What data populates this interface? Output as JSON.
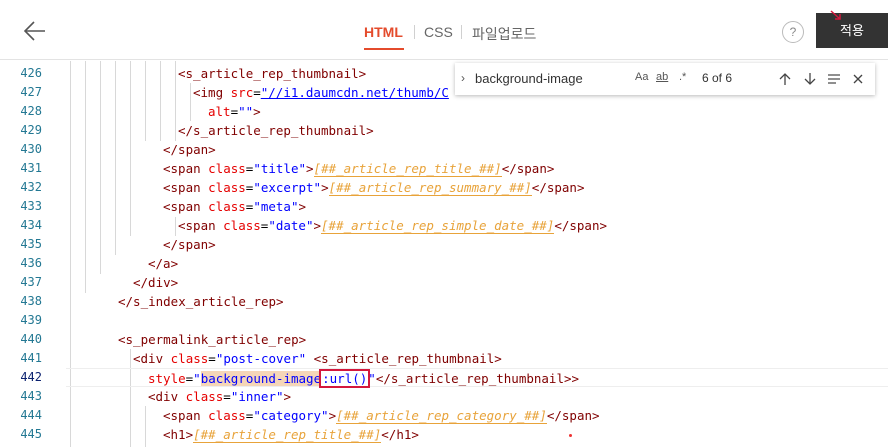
{
  "topbar": {
    "tabs": [
      "HTML",
      "CSS",
      "파일업로드"
    ],
    "active_tab": "HTML",
    "help_label": "?",
    "apply_label": "적용"
  },
  "find": {
    "query": "background-image",
    "opt_case": "Aa",
    "opt_word": "ab",
    "opt_regex": ".*",
    "count": "6 of 6"
  },
  "gutter": [
    "426",
    "427",
    "428",
    "429",
    "430",
    "431",
    "432",
    "433",
    "434",
    "435",
    "436",
    "437",
    "438",
    "439",
    "440",
    "441",
    "442",
    "443",
    "444",
    "445"
  ],
  "lines": {
    "l426": "<s_article_rep_thumbnail>",
    "l427_tag": "<img ",
    "l427_attr": "src",
    "l427_eq": "=",
    "l427_val": "\"//i1.daumcdn.net/thumb/C",
    "l428_attr": "alt",
    "l428_eq": "=",
    "l428_val": "\"\"",
    "l428_close": ">",
    "l429": "</s_article_rep_thumbnail>",
    "l430": "</span>",
    "l431_open": "<span ",
    "l431_attr": "class",
    "l431_eq": "=",
    "l431_val": "\"title\"",
    "l431_gt": ">",
    "l431_ph": "[##_article_rep_title_##]",
    "l431_close": "</span>",
    "l432_open": "<span ",
    "l432_attr": "class",
    "l432_eq": "=",
    "l432_val": "\"excerpt\"",
    "l432_gt": ">",
    "l432_ph": "[##_article_rep_summary_##]",
    "l432_close": "</span>",
    "l433_open": "<span ",
    "l433_attr": "class",
    "l433_eq": "=",
    "l433_val": "\"meta\"",
    "l433_gt": ">",
    "l434_open": "<span ",
    "l434_attr": "class",
    "l434_eq": "=",
    "l434_val": "\"date\"",
    "l434_gt": ">",
    "l434_ph": "[##_article_rep_simple_date_##]",
    "l434_close": "</span>",
    "l435": "</span>",
    "l436": "</a>",
    "l437": "</div>",
    "l438": "</s_index_article_rep>",
    "l440": "<s_permalink_article_rep>",
    "l441_open": "<div ",
    "l441_attr": "class",
    "l441_eq": "=",
    "l441_val": "\"post-cover\"",
    "l441_tag2": " <s_article_rep_thumbnail>",
    "l442_attr": "style",
    "l442_eq": "=",
    "l442_q": "\"",
    "l442_hl": "background-image",
    "l442_colon": ":",
    "l442_url": "url(",
    "l442_paren": ")",
    "l442_q2": "\"",
    "l442_tag": "</s_article_rep_thumbnail>>",
    "l443_open": "<div ",
    "l443_attr": "class",
    "l443_eq": "=",
    "l443_val": "\"inner\"",
    "l443_gt": ">",
    "l444_open": "<span ",
    "l444_attr": "class",
    "l444_eq": "=",
    "l444_val": "\"category\"",
    "l444_gt": ">",
    "l444_ph": "[##_article_rep_category_##]",
    "l444_close": "</span>",
    "l445_open": "<h1>",
    "l445_ph": "[##_article_rep_title_##]",
    "l445_close": "</h1>"
  }
}
